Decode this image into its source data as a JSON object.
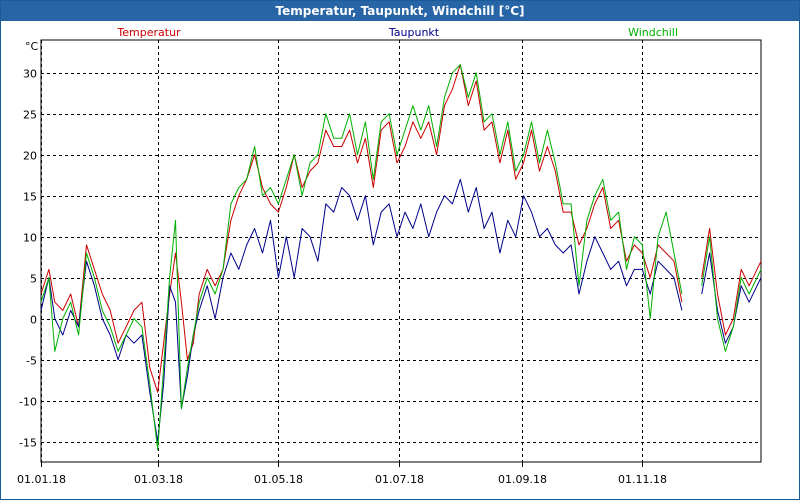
{
  "window": {
    "title": "Temperatur, Taupunkt, Windchill [°C]"
  },
  "chart_data": {
    "type": "line",
    "title": "Temperatur, Taupunkt, Windchill [°C]",
    "ylabel": "°C",
    "xlabel": "",
    "ylim": [
      -17.5,
      34
    ],
    "yticks": [
      -15,
      -10,
      -5,
      0,
      5,
      10,
      15,
      20,
      25,
      30
    ],
    "xlim": [
      "2018-01-01",
      "2018-12-31"
    ],
    "xticks": [
      {
        "date": "2018-01-01",
        "label": "01.01.18"
      },
      {
        "date": "2018-03-01",
        "label": "01.03.18"
      },
      {
        "date": "2018-05-01",
        "label": "01.05.18"
      },
      {
        "date": "2018-07-01",
        "label": "01.07.18"
      },
      {
        "date": "2018-09-01",
        "label": "01.09.18"
      },
      {
        "date": "2018-11-01",
        "label": "01.11.18"
      }
    ],
    "grid": true,
    "legend_position": "top",
    "series": [
      {
        "name": "Temperatur",
        "color": "#cc0000",
        "points": [
          [
            "2018-01-01",
            3
          ],
          [
            "2018-01-05",
            6
          ],
          [
            "2018-01-08",
            2
          ],
          [
            "2018-01-12",
            1
          ],
          [
            "2018-01-16",
            3
          ],
          [
            "2018-01-20",
            -1
          ],
          [
            "2018-01-24",
            9
          ],
          [
            "2018-01-28",
            6
          ],
          [
            "2018-02-01",
            3
          ],
          [
            "2018-02-05",
            1
          ],
          [
            "2018-02-09",
            -3
          ],
          [
            "2018-02-13",
            -1
          ],
          [
            "2018-02-17",
            1
          ],
          [
            "2018-02-21",
            2
          ],
          [
            "2018-02-25",
            -6
          ],
          [
            "2018-03-01",
            -9
          ],
          [
            "2018-03-04",
            -3
          ],
          [
            "2018-03-07",
            3
          ],
          [
            "2018-03-10",
            8
          ],
          [
            "2018-03-13",
            2
          ],
          [
            "2018-03-16",
            -5
          ],
          [
            "2018-03-19",
            -3
          ],
          [
            "2018-03-22",
            3
          ],
          [
            "2018-03-26",
            6
          ],
          [
            "2018-03-30",
            4
          ],
          [
            "2018-04-03",
            6
          ],
          [
            "2018-04-07",
            12
          ],
          [
            "2018-04-11",
            15
          ],
          [
            "2018-04-15",
            17
          ],
          [
            "2018-04-19",
            20
          ],
          [
            "2018-04-23",
            16
          ],
          [
            "2018-04-27",
            14
          ],
          [
            "2018-05-01",
            13
          ],
          [
            "2018-05-05",
            16
          ],
          [
            "2018-05-09",
            20
          ],
          [
            "2018-05-13",
            16
          ],
          [
            "2018-05-17",
            18
          ],
          [
            "2018-05-21",
            19
          ],
          [
            "2018-05-25",
            23
          ],
          [
            "2018-05-29",
            21
          ],
          [
            "2018-06-02",
            21
          ],
          [
            "2018-06-06",
            23
          ],
          [
            "2018-06-10",
            19
          ],
          [
            "2018-06-14",
            22
          ],
          [
            "2018-06-18",
            16
          ],
          [
            "2018-06-22",
            23
          ],
          [
            "2018-06-26",
            24
          ],
          [
            "2018-06-30",
            19
          ],
          [
            "2018-07-04",
            21
          ],
          [
            "2018-07-08",
            24
          ],
          [
            "2018-07-12",
            22
          ],
          [
            "2018-07-16",
            24
          ],
          [
            "2018-07-20",
            20
          ],
          [
            "2018-07-24",
            26
          ],
          [
            "2018-07-28",
            28
          ],
          [
            "2018-08-01",
            31
          ],
          [
            "2018-08-05",
            26
          ],
          [
            "2018-08-09",
            29
          ],
          [
            "2018-08-13",
            23
          ],
          [
            "2018-08-17",
            24
          ],
          [
            "2018-08-21",
            19
          ],
          [
            "2018-08-25",
            23
          ],
          [
            "2018-08-29",
            17
          ],
          [
            "2018-09-02",
            19
          ],
          [
            "2018-09-06",
            23
          ],
          [
            "2018-09-10",
            18
          ],
          [
            "2018-09-14",
            21
          ],
          [
            "2018-09-18",
            18
          ],
          [
            "2018-09-22",
            13
          ],
          [
            "2018-09-26",
            13
          ],
          [
            "2018-09-30",
            9
          ],
          [
            "2018-10-04",
            11
          ],
          [
            "2018-10-08",
            14
          ],
          [
            "2018-10-12",
            16
          ],
          [
            "2018-10-16",
            11
          ],
          [
            "2018-10-20",
            12
          ],
          [
            "2018-10-24",
            7
          ],
          [
            "2018-10-28",
            9
          ],
          [
            "2018-11-01",
            8
          ],
          [
            "2018-11-05",
            5
          ],
          [
            "2018-11-09",
            9
          ],
          [
            "2018-11-13",
            8
          ],
          [
            "2018-11-17",
            7
          ],
          [
            "2018-11-21",
            2
          ],
          null,
          [
            "2018-12-01",
            5
          ],
          [
            "2018-12-05",
            11
          ],
          [
            "2018-12-09",
            3
          ],
          [
            "2018-12-13",
            -2
          ],
          [
            "2018-12-17",
            0
          ],
          [
            "2018-12-21",
            6
          ],
          [
            "2018-12-25",
            4
          ],
          [
            "2018-12-31",
            7
          ]
        ]
      },
      {
        "name": "Taupunkt",
        "color": "#00008b",
        "points": [
          [
            "2018-01-01",
            1
          ],
          [
            "2018-01-05",
            5
          ],
          [
            "2018-01-08",
            0
          ],
          [
            "2018-01-12",
            -2
          ],
          [
            "2018-01-16",
            1
          ],
          [
            "2018-01-20",
            -1
          ],
          [
            "2018-01-24",
            7
          ],
          [
            "2018-01-28",
            4
          ],
          [
            "2018-02-01",
            0
          ],
          [
            "2018-02-05",
            -2
          ],
          [
            "2018-02-09",
            -5
          ],
          [
            "2018-02-13",
            -2
          ],
          [
            "2018-02-17",
            -3
          ],
          [
            "2018-02-21",
            -2
          ],
          [
            "2018-02-25",
            -9
          ],
          [
            "2018-03-01",
            -15
          ],
          [
            "2018-03-04",
            -8
          ],
          [
            "2018-03-07",
            4
          ],
          [
            "2018-03-10",
            2
          ],
          [
            "2018-03-13",
            -11
          ],
          [
            "2018-03-16",
            -7
          ],
          [
            "2018-03-19",
            -2
          ],
          [
            "2018-03-22",
            1
          ],
          [
            "2018-03-26",
            4
          ],
          [
            "2018-03-30",
            0
          ],
          [
            "2018-04-03",
            5
          ],
          [
            "2018-04-07",
            8
          ],
          [
            "2018-04-11",
            6
          ],
          [
            "2018-04-15",
            9
          ],
          [
            "2018-04-19",
            11
          ],
          [
            "2018-04-23",
            8
          ],
          [
            "2018-04-27",
            12
          ],
          [
            "2018-05-01",
            5
          ],
          [
            "2018-05-05",
            10
          ],
          [
            "2018-05-09",
            5
          ],
          [
            "2018-05-13",
            11
          ],
          [
            "2018-05-17",
            10
          ],
          [
            "2018-05-21",
            7
          ],
          [
            "2018-05-25",
            14
          ],
          [
            "2018-05-29",
            13
          ],
          [
            "2018-06-02",
            16
          ],
          [
            "2018-06-06",
            15
          ],
          [
            "2018-06-10",
            12
          ],
          [
            "2018-06-14",
            15
          ],
          [
            "2018-06-18",
            9
          ],
          [
            "2018-06-22",
            13
          ],
          [
            "2018-06-26",
            14
          ],
          [
            "2018-06-30",
            10
          ],
          [
            "2018-07-04",
            13
          ],
          [
            "2018-07-08",
            11
          ],
          [
            "2018-07-12",
            14
          ],
          [
            "2018-07-16",
            10
          ],
          [
            "2018-07-20",
            13
          ],
          [
            "2018-07-24",
            15
          ],
          [
            "2018-07-28",
            14
          ],
          [
            "2018-08-01",
            17
          ],
          [
            "2018-08-05",
            13
          ],
          [
            "2018-08-09",
            16
          ],
          [
            "2018-08-13",
            11
          ],
          [
            "2018-08-17",
            13
          ],
          [
            "2018-08-21",
            8
          ],
          [
            "2018-08-25",
            12
          ],
          [
            "2018-08-29",
            10
          ],
          [
            "2018-09-02",
            15
          ],
          [
            "2018-09-06",
            13
          ],
          [
            "2018-09-10",
            10
          ],
          [
            "2018-09-14",
            11
          ],
          [
            "2018-09-18",
            9
          ],
          [
            "2018-09-22",
            8
          ],
          [
            "2018-09-26",
            9
          ],
          [
            "2018-09-30",
            3
          ],
          [
            "2018-10-04",
            7
          ],
          [
            "2018-10-08",
            10
          ],
          [
            "2018-10-12",
            8
          ],
          [
            "2018-10-16",
            6
          ],
          [
            "2018-10-20",
            7
          ],
          [
            "2018-10-24",
            4
          ],
          [
            "2018-10-28",
            6
          ],
          [
            "2018-11-01",
            6
          ],
          [
            "2018-11-05",
            3
          ],
          [
            "2018-11-09",
            7
          ],
          [
            "2018-11-13",
            6
          ],
          [
            "2018-11-17",
            5
          ],
          [
            "2018-11-21",
            1
          ],
          null,
          [
            "2018-12-01",
            3
          ],
          [
            "2018-12-05",
            8
          ],
          [
            "2018-12-09",
            1
          ],
          [
            "2018-12-13",
            -3
          ],
          [
            "2018-12-17",
            -1
          ],
          [
            "2018-12-21",
            4
          ],
          [
            "2018-12-25",
            2
          ],
          [
            "2018-12-31",
            5
          ]
        ]
      },
      {
        "name": "Windchill",
        "color": "#00b000",
        "points": [
          [
            "2018-01-01",
            2
          ],
          [
            "2018-01-05",
            5
          ],
          [
            "2018-01-08",
            -4
          ],
          [
            "2018-01-12",
            0
          ],
          [
            "2018-01-16",
            2
          ],
          [
            "2018-01-20",
            -2
          ],
          [
            "2018-01-24",
            8
          ],
          [
            "2018-01-28",
            5
          ],
          [
            "2018-02-01",
            1
          ],
          [
            "2018-02-05",
            -1
          ],
          [
            "2018-02-09",
            -4
          ],
          [
            "2018-02-13",
            -2
          ],
          [
            "2018-02-17",
            0
          ],
          [
            "2018-02-21",
            -1
          ],
          [
            "2018-02-25",
            -8
          ],
          [
            "2018-03-01",
            -16
          ],
          [
            "2018-03-04",
            -6
          ],
          [
            "2018-03-07",
            5
          ],
          [
            "2018-03-10",
            12
          ],
          [
            "2018-03-13",
            -11
          ],
          [
            "2018-03-16",
            -6
          ],
          [
            "2018-03-19",
            -2
          ],
          [
            "2018-03-22",
            2
          ],
          [
            "2018-03-26",
            5
          ],
          [
            "2018-03-30",
            3
          ],
          [
            "2018-04-03",
            6
          ],
          [
            "2018-04-07",
            14
          ],
          [
            "2018-04-11",
            16
          ],
          [
            "2018-04-15",
            17
          ],
          [
            "2018-04-19",
            21
          ],
          [
            "2018-04-23",
            15
          ],
          [
            "2018-04-27",
            16
          ],
          [
            "2018-05-01",
            14
          ],
          [
            "2018-05-05",
            17
          ],
          [
            "2018-05-09",
            20
          ],
          [
            "2018-05-13",
            15
          ],
          [
            "2018-05-17",
            19
          ],
          [
            "2018-05-21",
            20
          ],
          [
            "2018-05-25",
            25
          ],
          [
            "2018-05-29",
            22
          ],
          [
            "2018-06-02",
            22
          ],
          [
            "2018-06-06",
            25
          ],
          [
            "2018-06-10",
            20
          ],
          [
            "2018-06-14",
            24
          ],
          [
            "2018-06-18",
            17
          ],
          [
            "2018-06-22",
            24
          ],
          [
            "2018-06-26",
            25
          ],
          [
            "2018-06-30",
            20
          ],
          [
            "2018-07-04",
            23
          ],
          [
            "2018-07-08",
            26
          ],
          [
            "2018-07-12",
            23
          ],
          [
            "2018-07-16",
            26
          ],
          [
            "2018-07-20",
            21
          ],
          [
            "2018-07-24",
            27
          ],
          [
            "2018-07-28",
            30
          ],
          [
            "2018-08-01",
            31
          ],
          [
            "2018-08-05",
            27
          ],
          [
            "2018-08-09",
            30
          ],
          [
            "2018-08-13",
            24
          ],
          [
            "2018-08-17",
            25
          ],
          [
            "2018-08-21",
            20
          ],
          [
            "2018-08-25",
            24
          ],
          [
            "2018-08-29",
            18
          ],
          [
            "2018-09-02",
            20
          ],
          [
            "2018-09-06",
            24
          ],
          [
            "2018-09-10",
            19
          ],
          [
            "2018-09-14",
            23
          ],
          [
            "2018-09-18",
            19
          ],
          [
            "2018-09-22",
            14
          ],
          [
            "2018-09-26",
            14
          ],
          [
            "2018-09-30",
            4
          ],
          [
            "2018-10-04",
            12
          ],
          [
            "2018-10-08",
            15
          ],
          [
            "2018-10-12",
            17
          ],
          [
            "2018-10-16",
            12
          ],
          [
            "2018-10-20",
            13
          ],
          [
            "2018-10-24",
            6
          ],
          [
            "2018-10-28",
            10
          ],
          [
            "2018-11-01",
            9
          ],
          [
            "2018-11-05",
            0
          ],
          [
            "2018-11-09",
            10
          ],
          [
            "2018-11-13",
            13
          ],
          [
            "2018-11-17",
            8
          ],
          [
            "2018-11-21",
            3
          ],
          null,
          [
            "2018-12-01",
            4
          ],
          [
            "2018-12-05",
            10
          ],
          [
            "2018-12-09",
            0
          ],
          [
            "2018-12-13",
            -4
          ],
          [
            "2018-12-17",
            -1
          ],
          [
            "2018-12-21",
            5
          ],
          [
            "2018-12-25",
            3
          ],
          [
            "2018-12-31",
            6
          ]
        ]
      }
    ]
  }
}
